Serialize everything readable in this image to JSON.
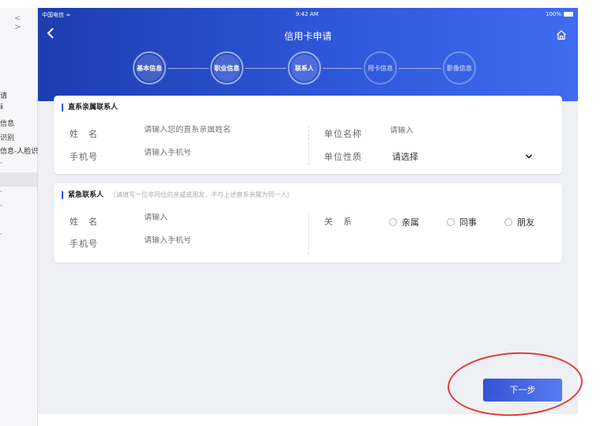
{
  "sidebar": {
    "nav_arrows": "< >",
    "items": [
      "请",
      "ⅱ",
      "信息",
      "识别",
      "信息-人脸识",
      "·",
      "·",
      "·",
      "·"
    ]
  },
  "statusbar": {
    "carrier": "中国电信 ≈",
    "time": "9:42 AM",
    "battery": "100%"
  },
  "header": {
    "back_icon": "chevron-left-icon",
    "title": "信用卡申请",
    "home_icon": "home-icon"
  },
  "steps": [
    {
      "label": "基本信息",
      "state": "done"
    },
    {
      "label": "职业信息",
      "state": "done"
    },
    {
      "label": "联系人",
      "state": "current"
    },
    {
      "label": "用卡信息",
      "state": "todo"
    },
    {
      "label": "影像信息",
      "state": "todo"
    }
  ],
  "direct_contact": {
    "title": "直系亲属联系人",
    "name_label": "姓　名",
    "name_placeholder": "请输入您的直系亲属姓名",
    "phone_label": "手机号",
    "phone_placeholder": "请输入手机号",
    "company_label": "单位名称",
    "company_placeholder": "请输入",
    "company_type_label": "单位性质",
    "company_type_value": "请选择"
  },
  "emergency_contact": {
    "title": "紧急联系人",
    "note": "（请填写一位非同住的亲戚或朋友，不与上述直系亲属为同一人）",
    "name_label": "姓　名",
    "name_placeholder": "请输入",
    "phone_label": "手机号",
    "phone_placeholder": "请输入手机号",
    "relation_label": "关　系",
    "relation_options": [
      "亲属",
      "同事",
      "朋友"
    ]
  },
  "footer": {
    "next_label": "下一步"
  },
  "colors": {
    "brand": "#2f57d9",
    "annotation": "#e23a3a"
  }
}
